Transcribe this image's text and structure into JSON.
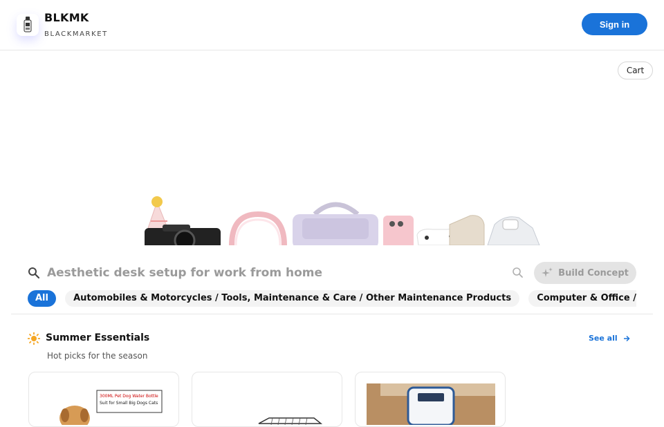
{
  "header": {
    "brand_title": "BLKMK",
    "brand_subtitle": "BLACKMARKET",
    "signin_label": "Sign in",
    "logo_icon": "product-bottle-icon"
  },
  "cart_label": "Cart",
  "search": {
    "placeholder": "Aesthetic desk setup for work from home",
    "build_label": "Build Concept"
  },
  "chips": [
    {
      "label": "All",
      "active": true
    },
    {
      "label": "Automobiles & Motorcycles / Tools, Maintenance & Care / Other Maintenance Products",
      "active": false
    },
    {
      "label": "Computer & Office / Office Electronics",
      "active": false
    }
  ],
  "section": {
    "title": "Summer Essentials",
    "subtitle": "Hot picks for the season",
    "see_all_label": "See all",
    "icon": "sun-icon"
  },
  "cards": [
    {
      "image_text_line1": "300ML Pet Dog Water Bottle",
      "image_text_line2": "Suit for Small Big Dogs Cats"
    },
    {
      "image": "pet-cage"
    },
    {
      "image": "blue-white-device"
    }
  ],
  "colors": {
    "accent": "#1a73d9",
    "sun": "#f5a623"
  }
}
